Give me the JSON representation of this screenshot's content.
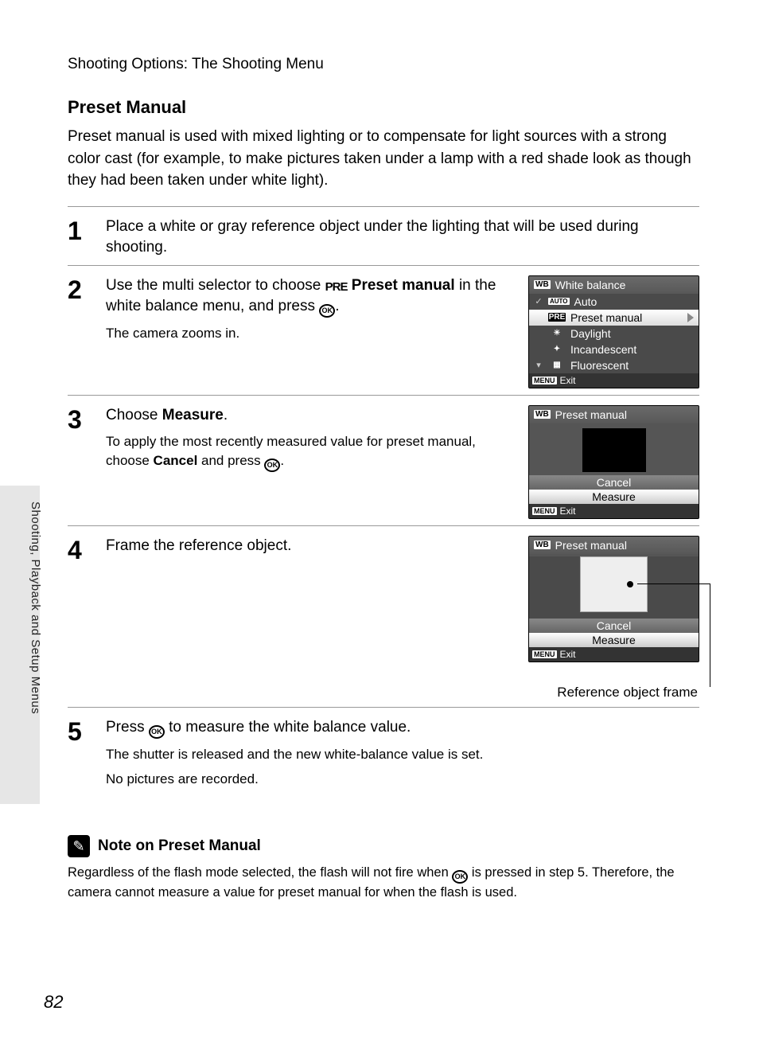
{
  "chapter": "Shooting Options: The Shooting Menu",
  "section_title": "Preset Manual",
  "intro": "Preset manual is used with mixed lighting or to compensate for light sources with a strong color cast (for example, to make pictures taken under a lamp with a red shade look as though they had been taken under white light).",
  "sidetab": "Shooting, Playback and Setup Menus",
  "page_number": "82",
  "steps": {
    "s1": {
      "num": "1",
      "body": "Place a white or gray reference object under the lighting that will be used during shooting."
    },
    "s2": {
      "num": "2",
      "body_pre": "Use the multi selector to choose ",
      "body_bold": "Preset manual",
      "body_mid": " in the white balance menu, and press ",
      "body_post": ".",
      "sub": "The camera zooms in."
    },
    "s3": {
      "num": "3",
      "body_pre": "Choose ",
      "body_bold": "Measure",
      "body_post": ".",
      "sub_pre": "To apply the most recently measured value for preset manual, choose ",
      "sub_bold": "Cancel",
      "sub_mid": " and press ",
      "sub_post": "."
    },
    "s4": {
      "num": "4",
      "body": "Frame the reference object.",
      "caption": "Reference object frame"
    },
    "s5": {
      "num": "5",
      "body_pre": "Press ",
      "body_post": " to measure the white balance value.",
      "sub1": "The shutter is released and the new white-balance value is set.",
      "sub2": "No pictures are recorded."
    }
  },
  "screens": {
    "wb_menu": {
      "title": "White balance",
      "items": [
        "Auto",
        "Preset manual",
        "Daylight",
        "Incandescent",
        "Fluorescent"
      ],
      "exit": "Exit",
      "menu_chip": "MENU",
      "wb_chip": "WB",
      "auto_chip": "AUTO",
      "pre_chip": "PRE"
    },
    "pm_menu": {
      "title": "Preset manual",
      "cancel": "Cancel",
      "measure": "Measure",
      "exit": "Exit",
      "menu_chip": "MENU",
      "wb_chip": "WB"
    }
  },
  "note": {
    "title": "Note on Preset Manual",
    "body_pre": "Regardless of the flash mode selected, the flash will not fire when ",
    "body_post": " is pressed in step 5. Therefore, the camera cannot measure a value for preset manual for when the flash is used."
  }
}
